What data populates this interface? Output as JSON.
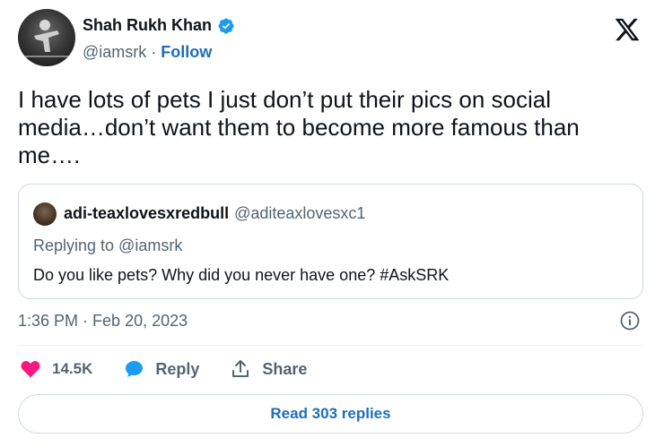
{
  "author": {
    "name": "Shah Rukh Khan",
    "handle": "@iamsrk",
    "separator": "·",
    "follow_label": "Follow",
    "verified_icon": "verified-badge-icon",
    "verified_color": "#1d9bf0"
  },
  "brand_icon": "x-logo-icon",
  "tweet": {
    "text": "I have lots of pets I just don’t put their pics on social media…don’t want them to become more famous than me…."
  },
  "quoted": {
    "name": "adi-teaxlovesxredbull",
    "handle": "@aditeaxlovesxc1",
    "replying_to": "Replying to @iamsrk",
    "text": "Do you like pets? Why did you never have one? #AskSRK"
  },
  "meta": {
    "time": "1:36 PM",
    "separator": "·",
    "date": "Feb 20, 2023",
    "info_icon": "info-icon"
  },
  "actions": {
    "like_count": "14.5K",
    "like_icon": "heart-icon",
    "like_color": "#f91880",
    "reply_label": "Reply",
    "reply_icon": "reply-bubble-icon",
    "reply_color": "#1d9bf0",
    "share_label": "Share",
    "share_icon": "share-upload-icon"
  },
  "read_replies_label": "Read 303 replies",
  "link_color": "#1d6fb8"
}
